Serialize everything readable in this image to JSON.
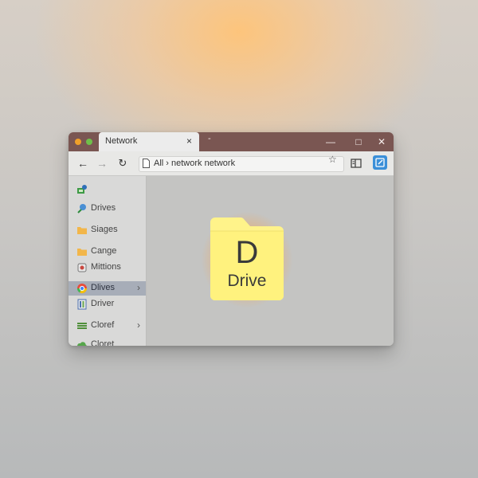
{
  "window": {
    "tab_title": "Network",
    "tab_close": "×",
    "tab_extra": "-",
    "minimize": "—",
    "maximize": "□",
    "close": "✕"
  },
  "toolbar": {
    "back": "←",
    "forward": "→",
    "refresh": "↻",
    "address": "All › network network",
    "star": "☆"
  },
  "sidebar": {
    "items": [
      {
        "label": "",
        "icon": "network-icon"
      },
      {
        "label": "Drives",
        "icon": "network-pin-icon"
      },
      {
        "label": "Siages",
        "icon": "folder-icon"
      },
      {
        "label": "Cange",
        "icon": "folder-icon"
      },
      {
        "label": "Mittions",
        "icon": "drive-icon"
      },
      {
        "label": "Dlives",
        "icon": "chrome-icon",
        "chevron": "›",
        "selected": true
      },
      {
        "label": "Driver",
        "icon": "server-icon"
      },
      {
        "label": "Cloref",
        "icon": "stack-icon",
        "chevron": "›"
      },
      {
        "label": "Cloret",
        "icon": "cloud-icon"
      }
    ]
  },
  "main": {
    "folder_letter": "D",
    "folder_label": "Drive"
  },
  "colors": {
    "titlebar": "#7a5652",
    "selection": "#a7adb8",
    "folder": "#fff27e",
    "accent": "#3b8fd8"
  }
}
